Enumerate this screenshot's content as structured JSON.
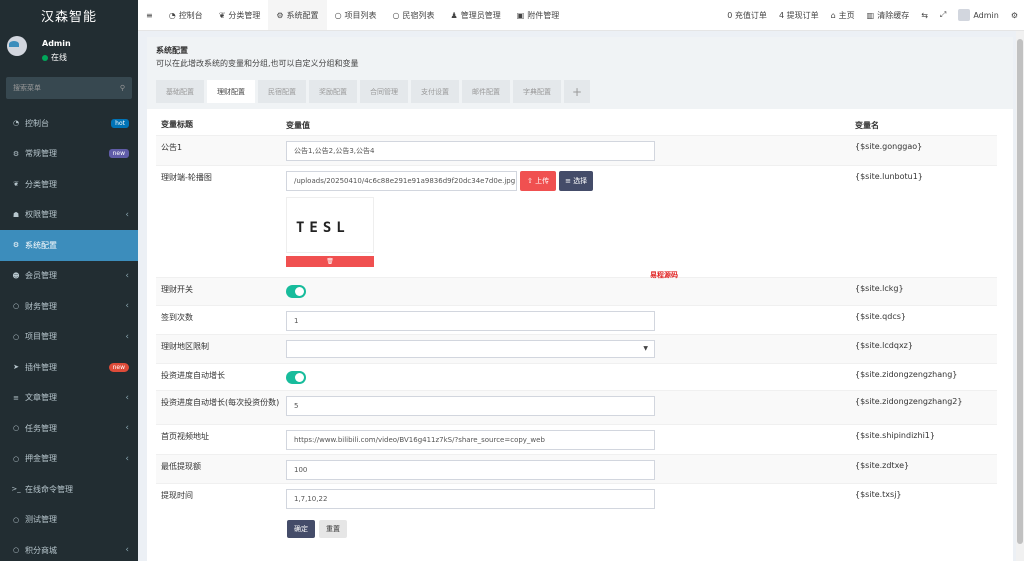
{
  "app": {
    "title": "汉森智能"
  },
  "user": {
    "name": "Admin",
    "status": "在线"
  },
  "search": {
    "placeholder": "搜索菜单"
  },
  "sidebar": {
    "items": [
      {
        "icon": "dashboard-icon",
        "glyph": "◔",
        "label": "控制台",
        "badge": "hot"
      },
      {
        "icon": "cogs-icon",
        "glyph": "⚙",
        "label": "常规管理",
        "badge": "new"
      },
      {
        "icon": "leaf-icon",
        "glyph": "❦",
        "label": "分类管理"
      },
      {
        "icon": "group-icon",
        "glyph": "☗",
        "label": "权限管理",
        "chevron": "‹"
      },
      {
        "icon": "gear-icon",
        "glyph": "⚙",
        "label": "系统配置"
      },
      {
        "icon": "user-circle-icon",
        "glyph": "☻",
        "label": "会员管理",
        "chevron": "‹"
      },
      {
        "icon": "circle-icon",
        "glyph": "○",
        "label": "财务管理",
        "chevron": "‹"
      },
      {
        "icon": "circle-icon",
        "glyph": "○",
        "label": "项目管理",
        "chevron": "‹"
      },
      {
        "icon": "rocket-icon",
        "glyph": "➤",
        "label": "插件管理",
        "badge": "new"
      },
      {
        "icon": "list-icon",
        "glyph": "≡",
        "label": "文章管理",
        "chevron": "‹"
      },
      {
        "icon": "circle-icon",
        "glyph": "○",
        "label": "任务管理",
        "chevron": "‹"
      },
      {
        "icon": "circle-icon",
        "glyph": "○",
        "label": "押金管理",
        "chevron": "‹"
      },
      {
        "icon": "terminal-icon",
        "glyph": ">_",
        "label": "在线命令管理"
      },
      {
        "icon": "circle-icon",
        "glyph": "○",
        "label": "测试管理"
      },
      {
        "icon": "circle-icon",
        "glyph": "○",
        "label": "积分商城",
        "chevron": "‹"
      }
    ]
  },
  "topbar": {
    "menu_toggle": "≡",
    "tabs": [
      {
        "icon": "dashboard-icon",
        "glyph": "◔",
        "label": "控制台"
      },
      {
        "icon": "leaf-icon",
        "glyph": "❦",
        "label": "分类管理"
      },
      {
        "icon": "gear-icon",
        "glyph": "⚙",
        "label": "系统配置"
      },
      {
        "icon": "circle-icon",
        "glyph": "○",
        "label": "项目列表"
      },
      {
        "icon": "circle-icon",
        "glyph": "○",
        "label": "民宿列表"
      },
      {
        "icon": "user-icon",
        "glyph": "♟",
        "label": "管理员管理"
      },
      {
        "icon": "image-icon",
        "glyph": "▣",
        "label": "附件管理"
      }
    ],
    "right": {
      "recharge": "0 充值订单",
      "withdraw": "4 提现订单",
      "home_icon": "⌂",
      "home": "主页",
      "cache_icon": "▥",
      "cache": "清除缓存",
      "translate_icon": "⇆",
      "fullscreen_icon": "⤢",
      "admin": "Admin",
      "settings_icon": "⚙"
    }
  },
  "panel": {
    "title": "系统配置",
    "subtitle": "可以在此增改系统的变量和分组,也可以自定义分组和变量",
    "tabs": [
      "基础配置",
      "理财配置",
      "民宿配置",
      "奖励配置",
      "合同管理",
      "支付设置",
      "邮件配置",
      "字典配置"
    ],
    "add_tab": "+"
  },
  "table": {
    "headers": {
      "title": "变量标题",
      "value": "变量值",
      "name": "变量名"
    },
    "rows": {
      "gonggao": {
        "title": "公告1",
        "value": "公告1,公告2,公告3,公告4",
        "name": "{$site.gonggao}"
      },
      "lunbotu": {
        "title": "理财端-轮播图",
        "value": "/uploads/20250410/4c6c88e291e91a9836d9f20dc34e7d0e.jpg",
        "name": "{$site.lunbotu1}",
        "upload": "上传",
        "choose": "选择",
        "preview_text": "TESL",
        "delete_icon": "🗑"
      },
      "lckg": {
        "title": "理财开关",
        "name": "{$site.lckg}",
        "enabled": true
      },
      "qdcs": {
        "title": "签到次数",
        "value": "1",
        "name": "{$site.qdcs}"
      },
      "lcdqxz": {
        "title": "理财地区限制",
        "value": "",
        "name": "{$site.lcdqxz}"
      },
      "zidongzengzhang": {
        "title": "投资进度自动增长",
        "name": "{$site.zidongzengzhang}",
        "enabled": true
      },
      "zidongzengzhang2": {
        "title": "投资进度自动增长(每次投资份数)",
        "value": "5",
        "name": "{$site.zidongzengzhang2}"
      },
      "shipindizhi": {
        "title": "首页视频地址",
        "value": "https://www.bilibili.com/video/BV16g411z7kS/?share_source=copy_web",
        "name": "{$site.shipindizhi1}"
      },
      "zdtxe": {
        "title": "最低提现额",
        "value": "100",
        "name": "{$site.zdtxe}"
      },
      "txsj": {
        "title": "提现时间",
        "value": "1,7,10,22",
        "name": "{$site.txsj}"
      }
    }
  },
  "watermark": "易程源码",
  "buttons": {
    "ok": "确定",
    "reset": "重置"
  },
  "colors": {
    "sidebar": "#222d32",
    "active": "#3c8dbc",
    "danger": "#f05050",
    "toggle": "#18bc9c",
    "primary_dark": "#444c69"
  }
}
